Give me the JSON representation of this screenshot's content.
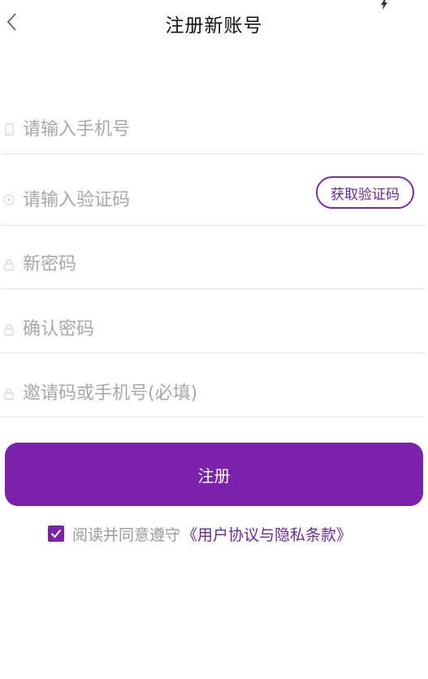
{
  "header": {
    "title": "注册新账号",
    "back_icon": "chevron-left-icon"
  },
  "form": {
    "phone": {
      "placeholder": "请输入手机号",
      "icon": "phone-icon"
    },
    "code": {
      "placeholder": "请输入验证码",
      "icon": "shield-icon",
      "button_label": "获取验证码"
    },
    "new_password": {
      "placeholder": "新密码",
      "icon": "lock-icon"
    },
    "confirm_password": {
      "placeholder": "确认密码",
      "icon": "lock-icon"
    },
    "invite": {
      "placeholder": "邀请码或手机号(必填)",
      "icon": "lock-icon"
    }
  },
  "register_button": {
    "label": "注册"
  },
  "agreement": {
    "checked": true,
    "text": "阅读并同意遵守",
    "link_text": "《用户协议与隐私条款》"
  },
  "colors": {
    "accent": "#7b22ad",
    "link": "#6a2a9e",
    "placeholder": "#a8a8a8",
    "divider": "#e6e6e6"
  }
}
